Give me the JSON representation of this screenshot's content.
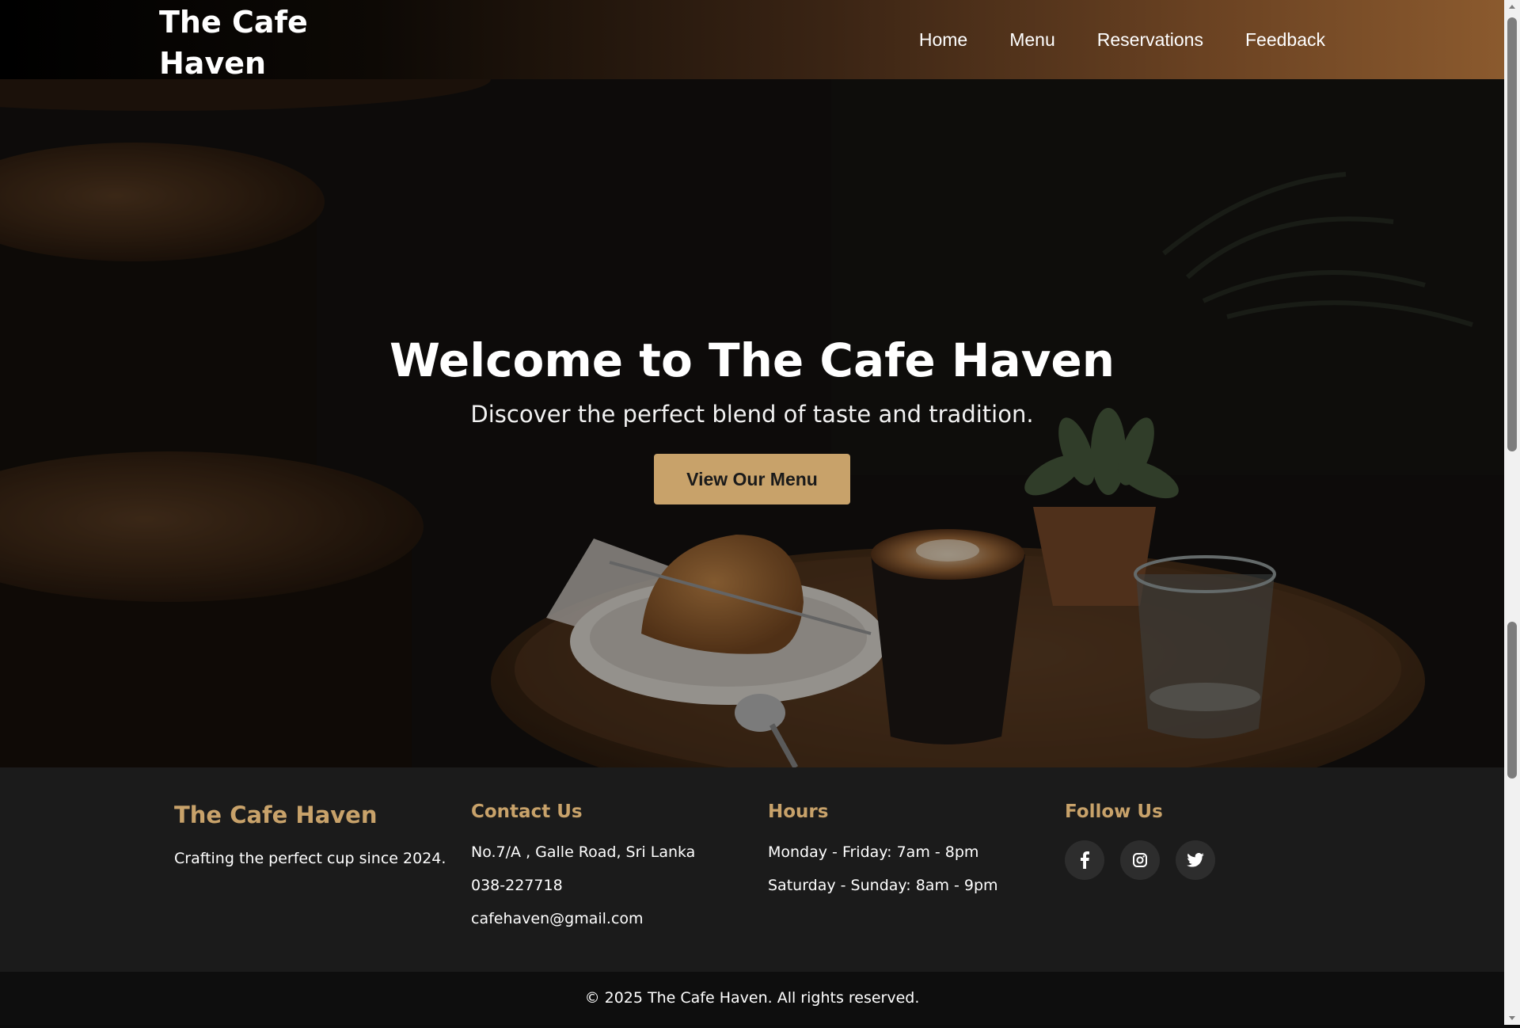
{
  "nav": {
    "brand": "The Cafe Haven",
    "links": [
      "Home",
      "Menu",
      "Reservations",
      "Feedback"
    ]
  },
  "hero": {
    "title": "Welcome to The Cafe Haven",
    "subtitle": "Discover the perfect blend of taste and tradition.",
    "button_label": "View Our Menu"
  },
  "footer": {
    "about": {
      "title": "The Cafe Haven",
      "text": "Crafting the perfect cup since 2024."
    },
    "contact": {
      "title": "Contact Us",
      "address": "No.7/A , Galle Road, Sri Lanka",
      "phone": "038-227718",
      "email": "cafehaven@gmail.com"
    },
    "hours": {
      "title": "Hours",
      "weekdays": "Monday - Friday: 7am - 8pm",
      "weekend": "Saturday - Sunday: 8am - 9pm"
    },
    "follow": {
      "title": "Follow Us",
      "icons": [
        "facebook-icon",
        "instagram-icon",
        "twitter-icon"
      ]
    },
    "copyright": "© 2025 The Cafe Haven. All rights reserved."
  },
  "colors": {
    "accent": "#c8a26a",
    "footer_bg": "#1b1b1b",
    "bottom_bar_bg": "#0e0e0e",
    "nav_gradient_end": "#8b5a2e"
  }
}
